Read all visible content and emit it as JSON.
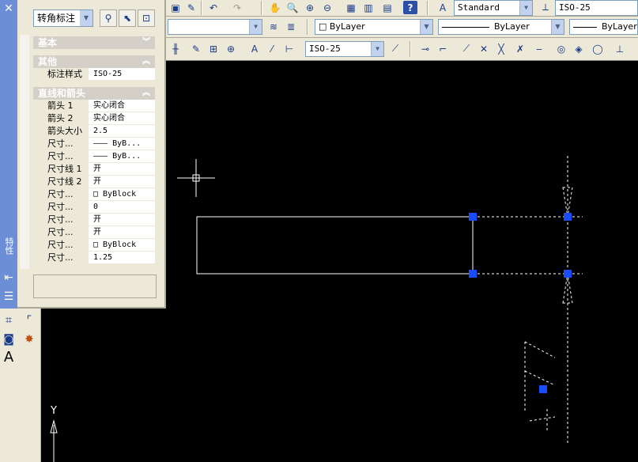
{
  "toolbar1": {
    "text_style": "Standard",
    "dim_style": "ISO-25",
    "help_glyph": "?"
  },
  "toolbar2": {
    "color": "ByLayer",
    "linetype": "ByLayer",
    "lineweight": "ByLayer"
  },
  "toolbar3": {
    "dim_style": "ISO-25"
  },
  "palette": {
    "object_type": "转角标注",
    "categories": [
      {
        "label": "基本"
      },
      {
        "label": "其他"
      },
      {
        "label": "直线和箭头"
      }
    ],
    "other_rows": [
      {
        "key": "标注样式",
        "value": "ISO-25"
      }
    ],
    "line_rows": [
      {
        "key": "箭头 1",
        "value": "实心闭合"
      },
      {
        "key": "箭头 2",
        "value": "实心闭合"
      },
      {
        "key": "箭头大小",
        "value": "2.5"
      },
      {
        "key": "尺寸...",
        "value": "——— ByB..."
      },
      {
        "key": "尺寸...",
        "value": "——— ByB..."
      },
      {
        "key": "尺寸线 1",
        "value": "开"
      },
      {
        "key": "尺寸线 2",
        "value": "开"
      },
      {
        "key": "尺寸...",
        "value": "□ ByBlock"
      },
      {
        "key": "尺寸...",
        "value": "0"
      },
      {
        "key": "尺寸...",
        "value": "开"
      },
      {
        "key": "尺寸...",
        "value": "开"
      },
      {
        "key": "尺寸...",
        "value": "□ ByBlock"
      },
      {
        "key": "尺寸...",
        "value": "1.25"
      }
    ],
    "side_label": "特性"
  },
  "canvas": {
    "ucs_label": "Y",
    "background": "#000000",
    "grip_color": "#1a4cff"
  }
}
